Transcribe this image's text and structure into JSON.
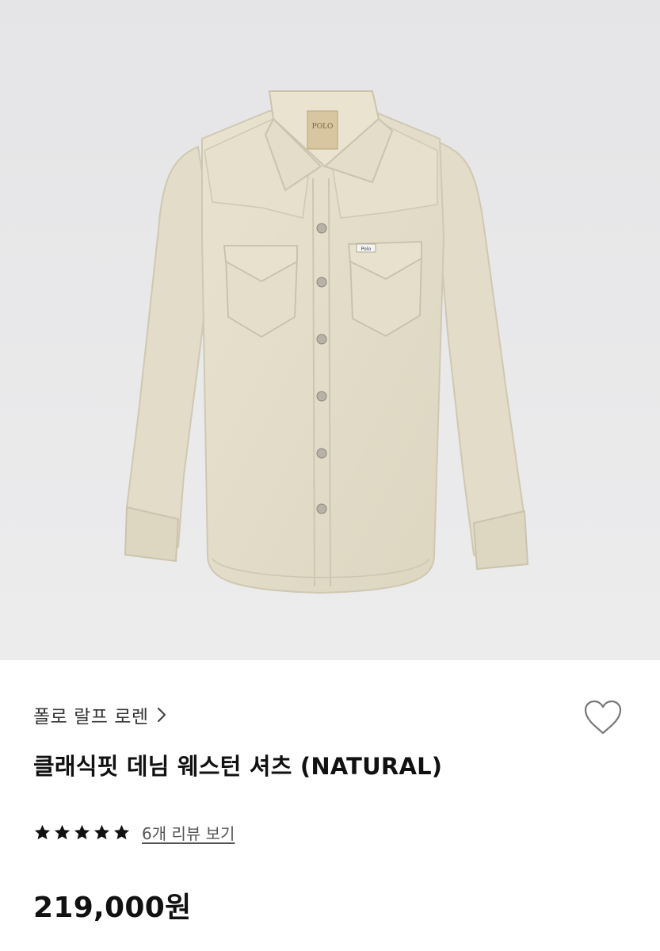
{
  "product": {
    "image_alt": "product-photo-shirt",
    "brand": "폴로 랄프 로렌",
    "title": "클래식핏 데님 웨스턴 셔츠 (NATURAL)",
    "rating": {
      "stars": 5,
      "max": 5
    },
    "review_link": "6개 리뷰 보기",
    "price": "219,000원",
    "label_text": "POLO",
    "pocket_tag_text": "Polo"
  },
  "icons": {
    "brand_chevron": "chevron-right-icon",
    "wishlist": "heart-outline-icon",
    "rating_star": "star-filled-icon"
  },
  "colors": {
    "image_background": "#e8e8e9",
    "shirt": "#e5dfcc",
    "text_primary": "#111111",
    "text_secondary": "#555555",
    "star": "#111111"
  }
}
